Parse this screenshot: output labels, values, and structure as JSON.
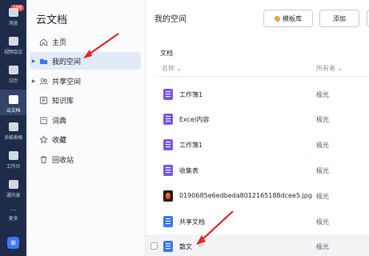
{
  "rail": {
    "badge": "198",
    "items": [
      {
        "label": "消息",
        "icon": "chat-icon"
      },
      {
        "label": "视频会议",
        "icon": "video-icon"
      },
      {
        "label": "日历",
        "icon": "calendar-icon"
      },
      {
        "label": "云文档",
        "icon": "document-icon",
        "active": true
      },
      {
        "label": "多维表格",
        "icon": "table-icon"
      },
      {
        "label": "工作台",
        "icon": "grid-icon"
      },
      {
        "label": "通讯录",
        "icon": "contacts-icon"
      },
      {
        "label": "更多",
        "icon": "more-icon"
      }
    ],
    "bottom_icon": "app-icon"
  },
  "sidebar": {
    "title": "云文档",
    "items": [
      {
        "label": "主页",
        "icon": "home-icon",
        "caret": false
      },
      {
        "label": "我的空间",
        "icon": "folder-icon",
        "caret": true,
        "active": true
      },
      {
        "label": "共享空间",
        "icon": "shared-icon",
        "caret": true
      },
      {
        "label": "知识库",
        "icon": "wiki-icon",
        "caret": false
      },
      {
        "label": "词典",
        "icon": "dictionary-icon",
        "caret": false
      },
      {
        "label": "收藏",
        "icon": "star-icon",
        "caret": false
      },
      {
        "label": "回收站",
        "icon": "trash-icon",
        "caret": false
      }
    ]
  },
  "main": {
    "title": "我的空间",
    "template_button": "模板库",
    "add_button": "添加",
    "section_label": "文档",
    "column_name": "名称",
    "column_owner": "所有者",
    "files": [
      {
        "name": "工作簿1",
        "owner": "极光",
        "type": "sheet"
      },
      {
        "name": "Excel内容",
        "owner": "极光",
        "type": "sheet"
      },
      {
        "name": "工作簿1",
        "owner": "极光",
        "type": "sheet"
      },
      {
        "name": "收集表",
        "owner": "极光",
        "type": "sheet"
      },
      {
        "name": "0190685e6edbeda8012165188dcee5.jpg",
        "owner": "极光",
        "type": "image"
      },
      {
        "name": "共享文档",
        "owner": "极光",
        "type": "doc"
      },
      {
        "name": "散文",
        "owner": "极光",
        "type": "doc",
        "starred": true,
        "hover": true
      }
    ]
  },
  "colors": {
    "rail_bg": "#1e2c4a",
    "accent": "#3b78f0",
    "annotation_arrow": "#e0282a"
  }
}
